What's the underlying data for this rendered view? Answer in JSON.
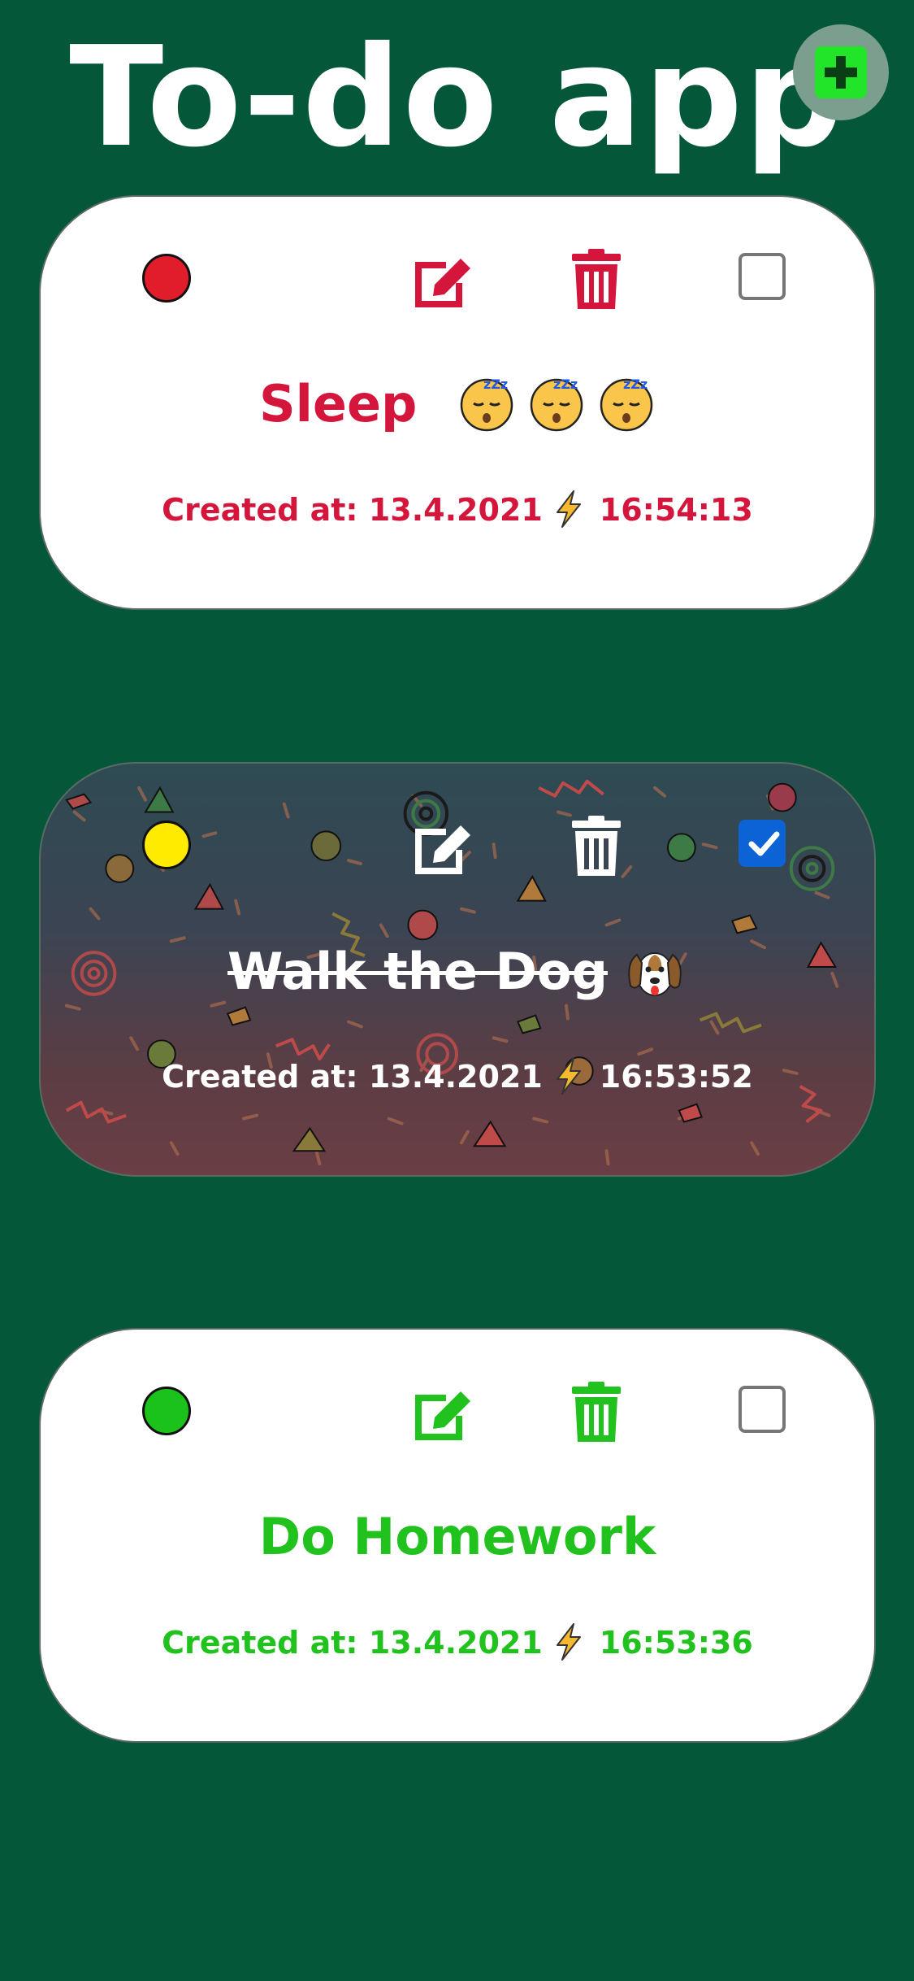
{
  "header": {
    "title": "To-do app",
    "add_icon": "plus-square-icon"
  },
  "todos": [
    {
      "title": "Sleep",
      "title_emoji": "sleeping-face",
      "title_emoji_count": 3,
      "created_label": "Created at: 13.4.2021",
      "created_time": "16:54:13",
      "priority_color": "#E21D2B",
      "text_color": "#D4163C",
      "completed": false
    },
    {
      "title": "Walk the Dog",
      "title_emoji": "dog-face",
      "created_label": "Created at: 13.4.2021",
      "created_time": "16:53:52",
      "priority_color": "#FFEB00",
      "text_color": "#FFFFFF",
      "completed": true
    },
    {
      "title": "Do Homework",
      "created_label": "Created at: 13.4.2021",
      "created_time": "16:53:36",
      "priority_color": "#1CC21C",
      "text_color": "#22C21E",
      "completed": false
    }
  ],
  "colors": {
    "background": "#05573A",
    "checkbox_checked": "#0B63D6",
    "bolt": "#F5B82E"
  }
}
